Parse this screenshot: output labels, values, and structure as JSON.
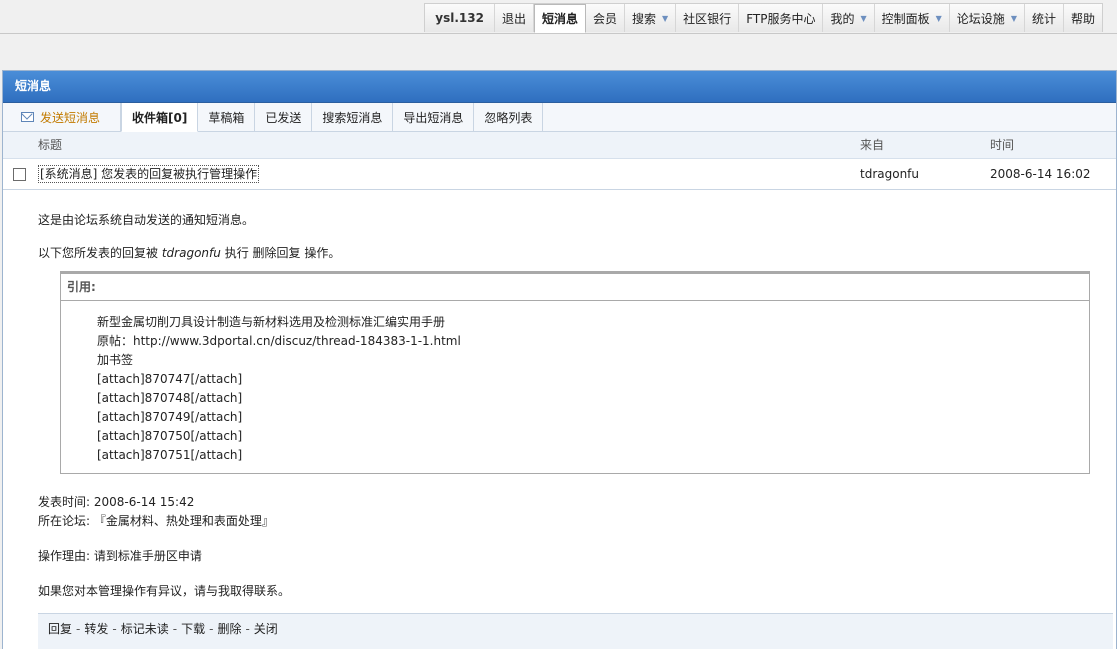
{
  "topnav": {
    "user": "ysl.132",
    "items": [
      {
        "label": "退出",
        "caret": false
      },
      {
        "label": "短消息",
        "caret": false,
        "active": true
      },
      {
        "label": "会员",
        "caret": false
      },
      {
        "label": "搜索",
        "caret": true
      },
      {
        "label": "社区银行",
        "caret": false
      },
      {
        "label": "FTP服务中心",
        "caret": false
      },
      {
        "label": "我的",
        "caret": true
      },
      {
        "label": "控制面板",
        "caret": true
      },
      {
        "label": "论坛设施",
        "caret": true
      },
      {
        "label": "统计",
        "caret": false
      },
      {
        "label": "帮助",
        "caret": false
      }
    ]
  },
  "panel": {
    "title": "短消息",
    "compose": "发送短消息",
    "tabs": [
      "收件箱[0]",
      "草稿箱",
      "已发送",
      "搜索短消息",
      "导出短消息",
      "忽略列表"
    ],
    "columns": {
      "subject": "标题",
      "from": "来自",
      "time": "时间"
    },
    "message": {
      "subject": "[系统消息] 您发表的回复被执行管理操作",
      "from": "tdragonfu",
      "time": "2008-6-14 16:02"
    }
  },
  "body": {
    "line1": "这是由论坛系统自动发送的通知短消息。",
    "line2_prefix": "以下您所发表的回复被",
    "line2_user": "tdragonfu",
    "line2_suffix": "执行 删除回复 操作。",
    "quote_title": "引用:",
    "quote_lines": [
      "新型金属切削刀具设计制造与新材料选用及检测标准汇编实用手册",
      "原帖：http://www.3dportal.cn/discuz/thread-184383-1-1.html",
      "加书签",
      "[attach]870747[/attach]",
      "[attach]870748[/attach]",
      "[attach]870749[/attach]",
      "[attach]870750[/attach]",
      "[attach]870751[/attach]"
    ],
    "post_time": "发表时间: 2008-6-14 15:42",
    "forum": "所在论坛: 『金属材料、热处理和表面处理』",
    "reason": "操作理由: 请到标准手册区申请",
    "contact": "如果您对本管理操作有异议，请与我取得联系。"
  },
  "actions": [
    "回复",
    "转发",
    "标记未读",
    "下载",
    "删除",
    "关闭"
  ],
  "colors": {
    "header": "#3a7fcf",
    "compose": "#c27b00"
  }
}
